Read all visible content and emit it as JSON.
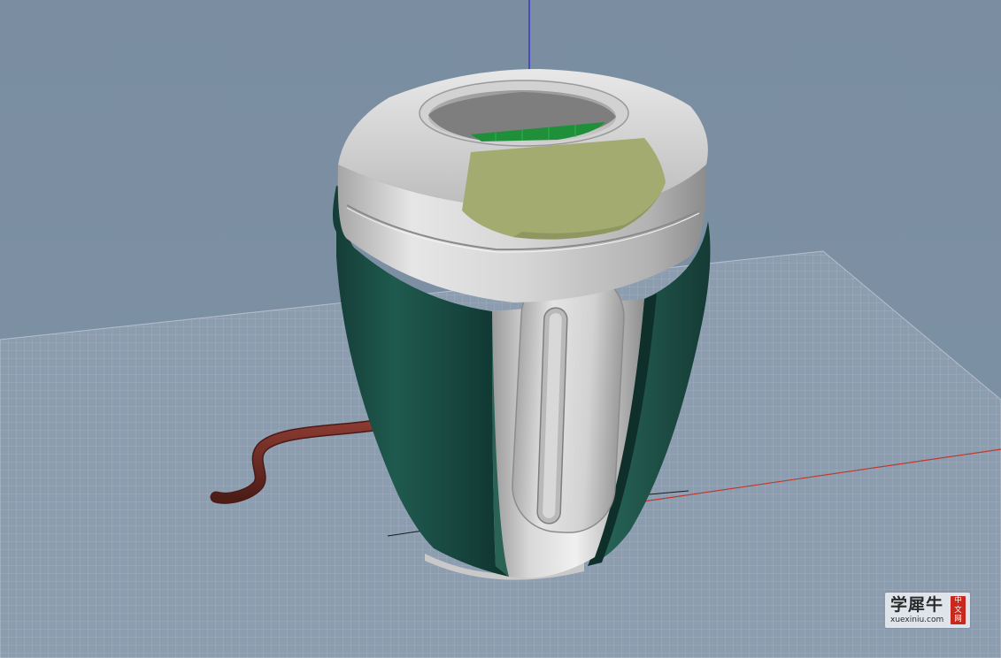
{
  "viewport": {
    "background_colors": {
      "sky_top": "#7a8da1",
      "sky_bottom": "#7c90a4",
      "grid_fill": "#8f9fb2",
      "grid_line": "#aab6c4"
    },
    "axis_colors": {
      "x_axis": "#c0392b",
      "z_axis": "#2a2ad0"
    },
    "model_colors": {
      "body_green": "#1a4a42",
      "silver": "#c6c6c6",
      "display_panel": "#a3ab70",
      "display_strip": "#1f8f3a",
      "cable": "#6b2a24"
    }
  },
  "watermark": {
    "chinese": "学犀牛",
    "url": "xuexiniu.com",
    "seal": [
      "中",
      "文",
      "网"
    ],
    "seal_color": "#c8281e"
  }
}
